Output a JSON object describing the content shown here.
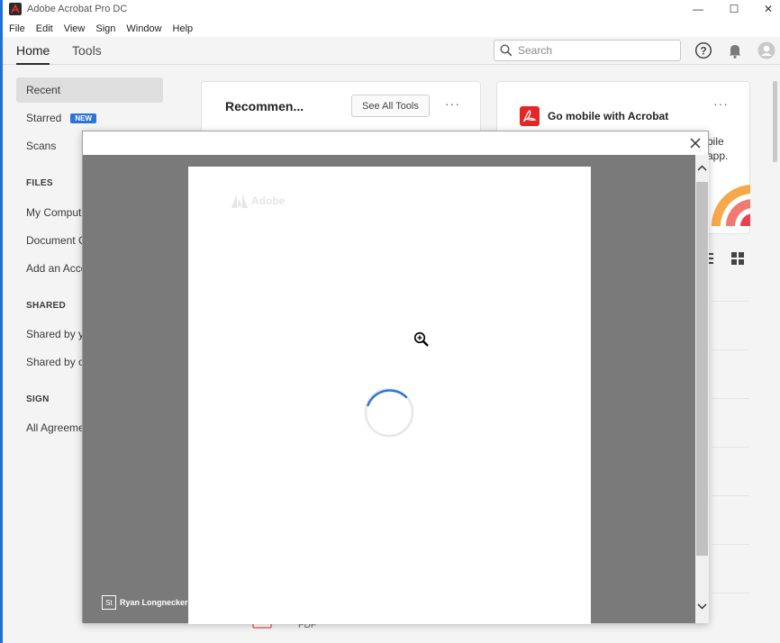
{
  "window": {
    "title": "Adobe Acrobat Pro DC",
    "controls": {
      "minimize": "—",
      "maximize": "☐",
      "close": "✕"
    }
  },
  "menu": [
    "File",
    "Edit",
    "View",
    "Sign",
    "Window",
    "Help"
  ],
  "nav": {
    "tabs": [
      "Home",
      "Tools"
    ],
    "active_tab": "Home",
    "search": {
      "placeholder": "Search",
      "value": ""
    },
    "icons": [
      "help-icon",
      "bell-icon",
      "avatar-icon"
    ]
  },
  "sidebar": {
    "items_top": [
      {
        "label": "Recent",
        "active": true
      },
      {
        "label": "Starred",
        "badge": "NEW"
      },
      {
        "label": "Scans"
      }
    ],
    "files_heading": "FILES",
    "files_items": [
      "My Comput",
      "Document C",
      "Add an Acco"
    ],
    "shared_heading": "SHARED",
    "shared_items": [
      "Shared by y",
      "Shared by o"
    ],
    "sign_heading": "SIGN",
    "sign_items": [
      "All Agreeme"
    ]
  },
  "cards": {
    "recommended": {
      "title": "Recommen...",
      "button": "See All Tools",
      "more": "···"
    },
    "mobile": {
      "title": "Go mobile with Acrobat",
      "line1_fragment": "bile",
      "line2_fragment": "app.",
      "more": "···"
    }
  },
  "file_list_fragment": {
    "type_label": "PDF"
  },
  "modal": {
    "watermark": "Adobe",
    "credit": "Ryan Longnecker",
    "credit_logo": "St",
    "state": "loading"
  },
  "colors": {
    "accent": "#2d74da",
    "pdf_red": "#e32626",
    "modal_backdrop": "#7a7a7a",
    "sidebar_active": "#dedede"
  }
}
